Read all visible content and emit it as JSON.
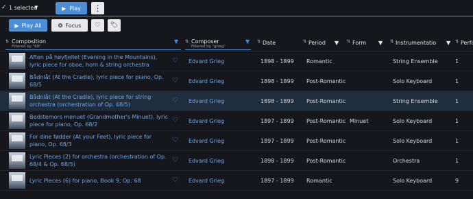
{
  "topbar": {
    "check_icon": "check-icon",
    "selection_label": "1 selected",
    "play_label": "Play",
    "more_icon": "more-vertical-icon"
  },
  "toolbar": {
    "play_all_label": "Play All",
    "focus_label": "Focus",
    "heart_icon": "heart-icon",
    "tag_icon": "tag-icon"
  },
  "columns": {
    "composition": {
      "label": "Composition",
      "filter": "Filtered by \"68\""
    },
    "composer": {
      "label": "Composer",
      "filter": "Filtered by \"grieg\""
    },
    "date": {
      "label": "Date"
    },
    "period": {
      "label": "Period"
    },
    "form": {
      "label": "Form"
    },
    "instrumentation": {
      "label": "Instrumentatio"
    },
    "performances": {
      "label": "Perfor"
    }
  },
  "rows": [
    {
      "composition": "Aften på høyfjellet (Evening in the Mountains), lyric piece for oboe, horn & string orchestra (orchestration of",
      "composer": "Edvard Grieg",
      "date": "1898 - 1899",
      "period": "Romantic",
      "form": "",
      "instrumentation": "String Ensemble",
      "performances": "1"
    },
    {
      "composition": "Bådnlåt (At the Cradle), lyric piece for piano, Op. 68/5",
      "composer": "Edvard Grieg",
      "date": "1898 - 1899",
      "period": "Post-Romantic",
      "form": "",
      "instrumentation": "Solo Keyboard",
      "performances": "1"
    },
    {
      "composition": "Bådnlåt (At the Cradle), lyric piece for string orchestra (orchestration of Op. 68/5)",
      "composer": "Edvard Grieg",
      "date": "1898 - 1899",
      "period": "Post-Romantic",
      "form": "",
      "instrumentation": "String Ensemble",
      "performances": "1"
    },
    {
      "composition": "Bedstemors menuet (Grandmother's Minuet), lyric piece for piano, Op. 68/2",
      "composer": "Edvard Grieg",
      "date": "1897 - 1899",
      "period": "Post-Romantic",
      "form": "Minuet",
      "instrumentation": "Solo Keyboard",
      "performances": "1"
    },
    {
      "composition": "For dine fødder (At your Feet), lyric piece for piano, Op. 68/3",
      "composer": "Edvard Grieg",
      "date": "1897 - 1899",
      "period": "Post-Romantic",
      "form": "",
      "instrumentation": "Solo Keyboard",
      "performances": "1"
    },
    {
      "composition": "Lyric Pieces (2) for orchestra (orchestration of Op. 68/4 & Op. 68/5)",
      "composer": "Edvard Grieg",
      "date": "1898 - 1899",
      "period": "Post-Romantic",
      "form": "",
      "instrumentation": "Orchestra",
      "performances": "1"
    },
    {
      "composition": "Lyric Pieces (6) for piano, Book 9, Op. 68",
      "composer": "Edvard Grieg",
      "date": "1897 - 1899",
      "period": "Romantic",
      "form": "",
      "instrumentation": "Solo Keyboard",
      "performances": "9"
    }
  ],
  "selected_row": 2,
  "colors": {
    "accent": "#4a8fd8",
    "link": "#6fa8e8",
    "background": "#15171c",
    "selected_row": "#1f2d3d"
  }
}
